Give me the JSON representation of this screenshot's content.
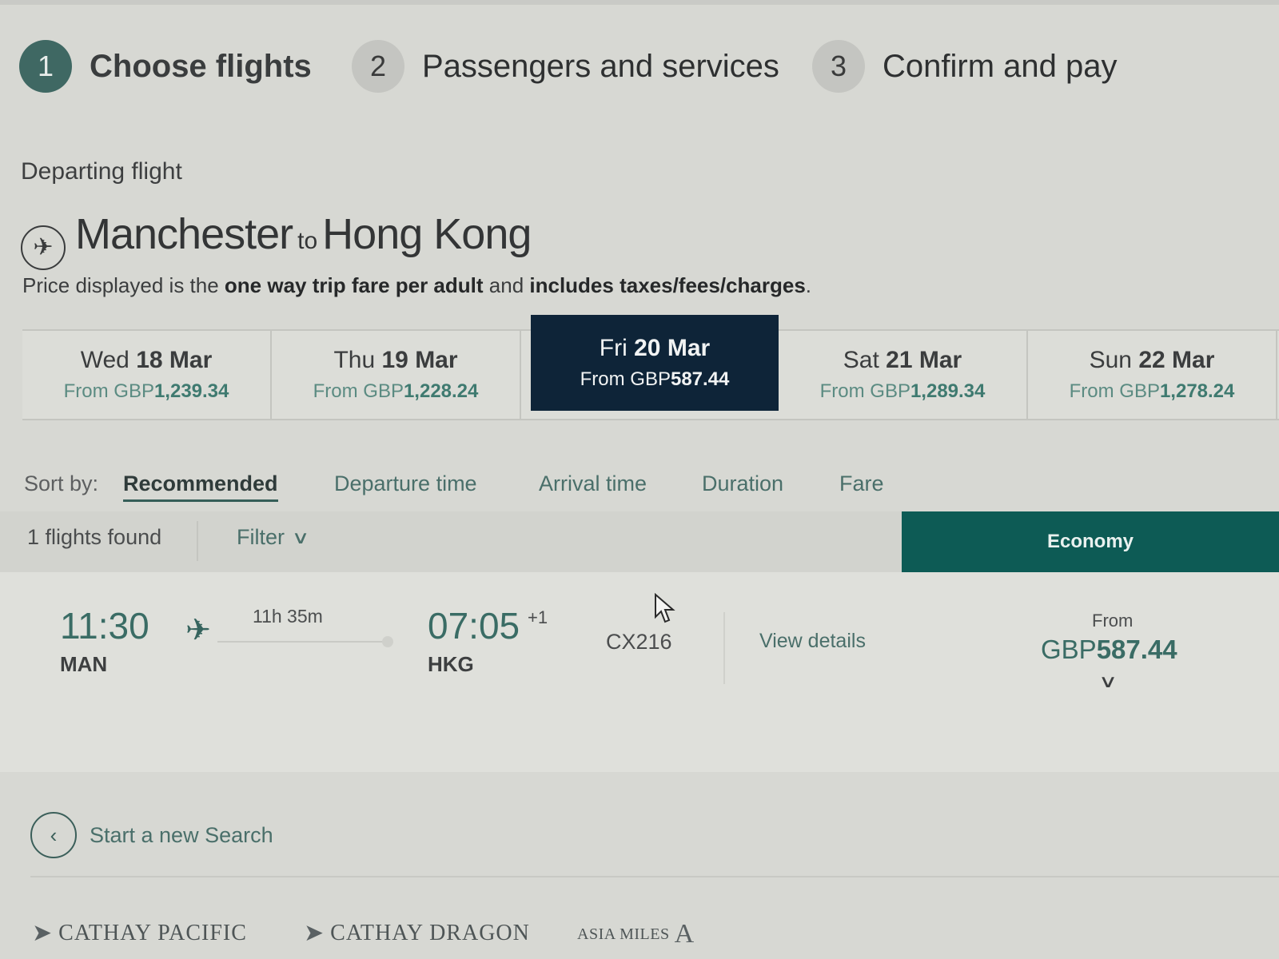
{
  "steps": [
    {
      "number": "1",
      "label": "Choose flights"
    },
    {
      "number": "2",
      "label": "Passengers and services"
    },
    {
      "number": "3",
      "label": "Confirm and pay"
    }
  ],
  "section": {
    "label": "Departing flight",
    "origin": "Manchester",
    "connector": "to",
    "destination": "Hong Kong",
    "note_prefix": "Price displayed is the ",
    "note_bold1": "one way trip fare per adult",
    "note_mid": " and ",
    "note_bold2": "includes taxes/fees/charges",
    "note_end": "."
  },
  "dates": [
    {
      "weekday": "Wed",
      "date": "18 Mar",
      "from": "From GBP",
      "price": "1,239.34"
    },
    {
      "weekday": "Thu",
      "date": "19 Mar",
      "from": "From GBP",
      "price": "1,228.24"
    },
    {
      "weekday": "Fri",
      "date": "20 Mar",
      "from": "From GBP",
      "price": "587.44"
    },
    {
      "weekday": "Sat",
      "date": "21 Mar",
      "from": "From GBP",
      "price": "1,289.34"
    },
    {
      "weekday": "Sun",
      "date": "22 Mar",
      "from": "From GBP",
      "price": "1,278.24"
    }
  ],
  "sort": {
    "label": "Sort by:",
    "options": [
      "Recommended",
      "Departure time",
      "Arrival time",
      "Duration",
      "Fare"
    ],
    "active": "Recommended"
  },
  "results": {
    "found": "1 flights found",
    "filter": "Filter",
    "cabin": "Economy"
  },
  "flight": {
    "dep_time": "11:30",
    "dep_code": "MAN",
    "duration": "11h 35m",
    "arr_time": "07:05",
    "day_offset": "+1",
    "arr_code": "HKG",
    "flight_no": "CX216",
    "details": "View details",
    "from": "From",
    "currency": "GBP",
    "price": "587.44"
  },
  "new_search": "Start a new Search",
  "footer_logos": [
    "CATHAY PACIFIC",
    "CATHAY DRAGON",
    "ASIA MILES"
  ],
  "colors": {
    "selected_date_bg": "#0e2438",
    "cabin_bg": "#0d5b55",
    "active_step": "#3f6863"
  }
}
